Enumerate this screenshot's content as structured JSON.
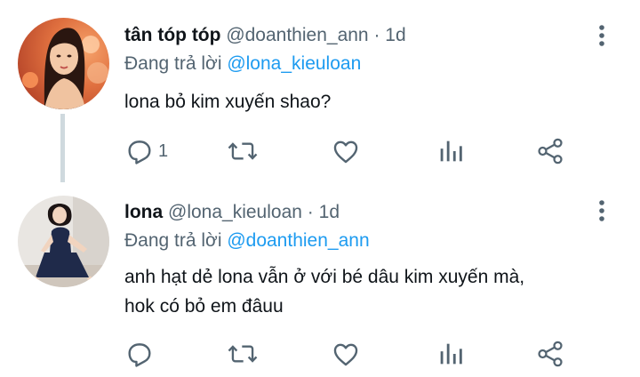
{
  "tweets": [
    {
      "name": "tân tóp tóp",
      "handle": "@doanthien_ann",
      "separator": "·",
      "time": "1d",
      "reply_prefix": "Đang trả lời",
      "reply_to": "@lona_kieuloan",
      "text": "lona bỏ kim xuyến shao?",
      "reply_count": "1",
      "icons": [
        "reply-icon",
        "retweet-icon",
        "like-icon",
        "analytics-icon",
        "share-icon",
        "more-icon"
      ]
    },
    {
      "name": "lona",
      "handle": "@lona_kieuloan",
      "separator": "·",
      "time": "1d",
      "reply_prefix": "Đang trả lời",
      "reply_to": "@doanthien_ann",
      "text": "anh hạt dẻ lona vẫn ở với bé dâu kim xuyến mà,\nhok có bỏ em đâuu",
      "reply_count": "",
      "icons": [
        "reply-icon",
        "retweet-icon",
        "like-icon",
        "analytics-icon",
        "share-icon",
        "more-icon"
      ]
    }
  ],
  "colors": {
    "accent": "#1d9bf0",
    "secondary_text": "#536471",
    "primary_text": "#0f1419",
    "thread_line": "#cfd9de"
  }
}
